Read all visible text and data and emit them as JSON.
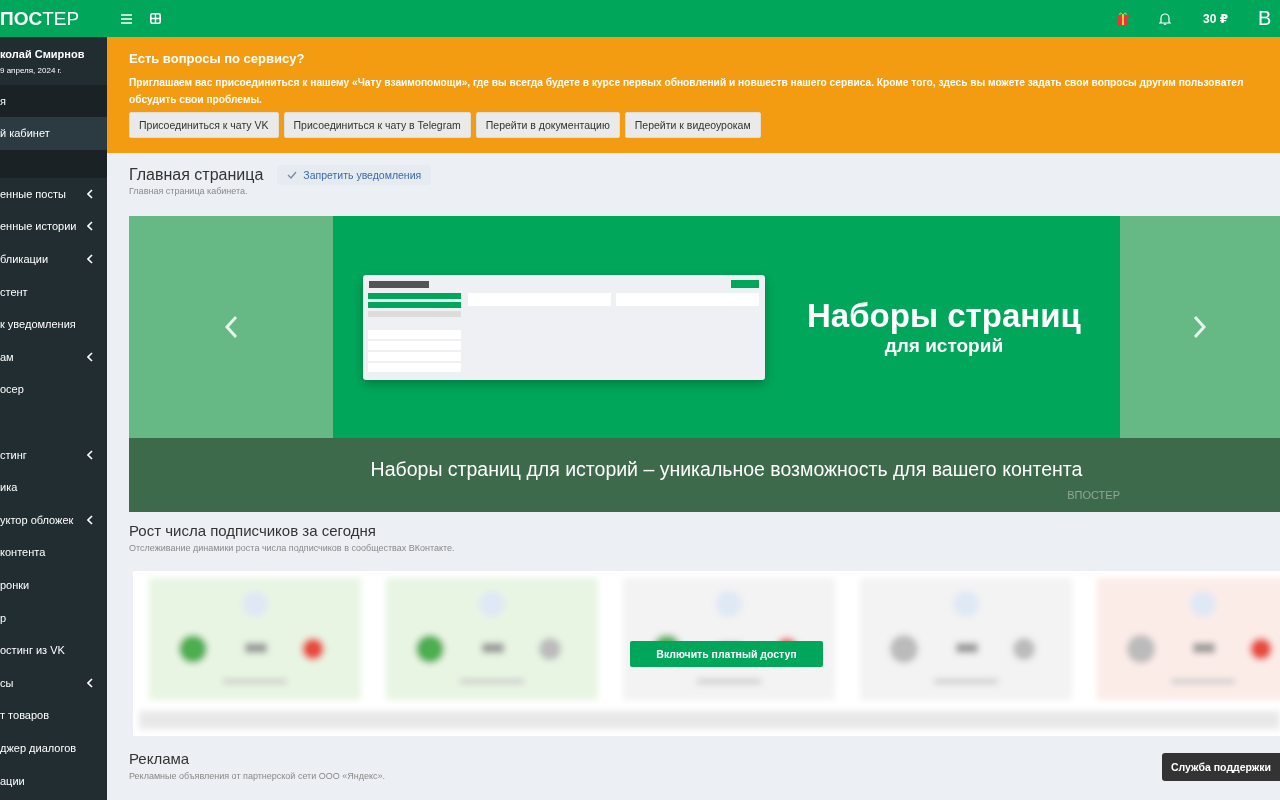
{
  "logo": "**ПОС**ТЕР",
  "header": {
    "balance": "30 ₽",
    "avatar_letter": "В"
  },
  "user": {
    "name": "колай Смирнов",
    "date": "9 апреля, 2024 г."
  },
  "sidebar": {
    "items": [
      {
        "kind": "header",
        "label": "я"
      },
      {
        "kind": "link",
        "label": "й кабинет",
        "selected": true,
        "expandable": false
      },
      {
        "kind": "gap"
      },
      {
        "kind": "link",
        "label": "енные посты",
        "selected": false,
        "expandable": true
      },
      {
        "kind": "link",
        "label": "енные истории",
        "selected": false,
        "expandable": true
      },
      {
        "kind": "link",
        "label": "бликации",
        "selected": false,
        "expandable": true
      },
      {
        "kind": "link",
        "label": "стент",
        "selected": false,
        "expandable": false
      },
      {
        "kind": "link",
        "label": "к уведомления",
        "selected": false,
        "expandable": false
      },
      {
        "kind": "link",
        "label": "ам",
        "selected": false,
        "expandable": true
      },
      {
        "kind": "link",
        "label": "осер",
        "selected": false,
        "expandable": false
      },
      {
        "kind": "gap"
      },
      {
        "kind": "link",
        "label": "стинг",
        "selected": false,
        "expandable": true
      },
      {
        "kind": "link",
        "label": "ика",
        "selected": false,
        "expandable": false
      },
      {
        "kind": "link",
        "label": "уктор обложек",
        "selected": false,
        "expandable": true
      },
      {
        "kind": "link",
        "label": "контента",
        "selected": false,
        "expandable": false
      },
      {
        "kind": "link",
        "label": "ронки",
        "selected": false,
        "expandable": false
      },
      {
        "kind": "link",
        "label": "р",
        "selected": false,
        "expandable": false
      },
      {
        "kind": "link",
        "label": "остинг из VK",
        "selected": false,
        "expandable": false
      },
      {
        "kind": "link",
        "label": "сы",
        "selected": false,
        "expandable": true
      },
      {
        "kind": "link",
        "label": "т товаров",
        "selected": false,
        "expandable": false
      },
      {
        "kind": "link",
        "label": "джер диалогов",
        "selected": false,
        "expandable": false
      },
      {
        "kind": "link",
        "label": "ации",
        "selected": false,
        "expandable": false
      }
    ]
  },
  "notice": {
    "title": "Есть вопросы по сервису?",
    "lines": [
      "Приглашаем вас присоединиться к нашему «Чату взаимопомощи», где вы всегда будете в курсе первых обновлений и новшеств нашего сервиса. Кроме того, здесь вы можете задать свои вопросы другим пользовател",
      "обсудить свои проблемы."
    ],
    "buttons": [
      "Присоединиться к чату VK",
      "Присоединиться к чату в Telegram",
      "Перейти в документацию",
      "Перейти к видеоурокам"
    ]
  },
  "page": {
    "title": "Главная страница",
    "subtitle": "Главная страница кабинета.",
    "notify_button": "Запретить уведомления"
  },
  "carousel": {
    "slide_title": "Наборы страниц",
    "slide_subtitle": "для историй",
    "caption": "Наборы страниц для историй – уникальное возможность для вашего контента",
    "brand": "ВПОСТЕР"
  },
  "subscribers": {
    "title": "Рост числа подписчиков за сегодня",
    "subtitle": "Отслеживание динамики роста числа подписчиков в сообществах ВКонтакте.",
    "unlock_button": "Включить платный доступ"
  },
  "ads": {
    "title": "Реклама",
    "subtitle": "Рекламные объявления от партнерской сети ООО «Яндекс»."
  },
  "support_button": "Служба поддержки"
}
